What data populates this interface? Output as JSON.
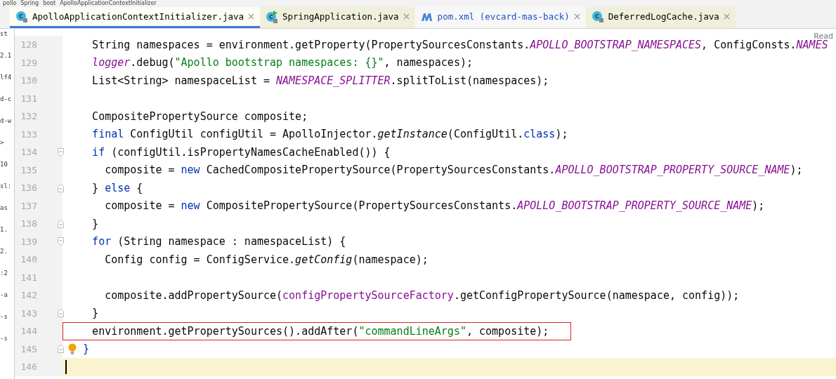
{
  "breadcrumb": [
    "pollo",
    "Spring",
    "boot",
    "ApolloApplicationContextInitializer"
  ],
  "tabs": [
    {
      "label": "ApolloApplicationContextInitializer.java",
      "kind": "class",
      "selected": true,
      "tinted": false,
      "modified": false
    },
    {
      "label": "SpringApplication.java",
      "kind": "runnable",
      "selected": false,
      "tinted": true,
      "modified": false
    },
    {
      "label": "pom.xml (evcard-mas-back)",
      "kind": "maven",
      "selected": false,
      "tinted": false,
      "modified": true
    },
    {
      "label": "DeferredLogCache.java",
      "kind": "class",
      "selected": false,
      "tinted": true,
      "modified": false
    }
  ],
  "project_panel_fragments": [
    "st",
    "2.1",
    "lf4",
    "d-c",
    "d-w",
    ">",
    "10",
    "sl:",
    "as",
    "1.",
    "2.",
    ":2",
    "-a",
    "-s",
    "-s"
  ],
  "reader_mode_label": "Read",
  "lines": [
    {
      "number": "128",
      "fold_start": false,
      "fold_end": false,
      "highlighted": false,
      "current": false,
      "segments": [
        {
          "kind": "plain",
          "text": "    String namespaces = environment.getProperty(PropertySourcesConstants."
        },
        {
          "kind": "constant",
          "text": "APOLLO_BOOTSTRAP_NAMESPACES"
        },
        {
          "kind": "plain",
          "text": ", ConfigConsts."
        },
        {
          "kind": "constant",
          "text": "NAMES"
        }
      ]
    },
    {
      "number": "129",
      "fold_start": false,
      "fold_end": false,
      "highlighted": false,
      "current": false,
      "segments": [
        {
          "kind": "static_field",
          "text": "    logger"
        },
        {
          "kind": "plain",
          "text": ".debug("
        },
        {
          "kind": "string",
          "text": "\"Apollo bootstrap namespaces: {}\""
        },
        {
          "kind": "plain",
          "text": ", namespaces);"
        }
      ]
    },
    {
      "number": "130",
      "fold_start": false,
      "fold_end": false,
      "highlighted": false,
      "current": false,
      "segments": [
        {
          "kind": "plain",
          "text": "    List<String> namespaceList = "
        },
        {
          "kind": "constant",
          "text": "NAMESPACE_SPLITTER"
        },
        {
          "kind": "plain",
          "text": ".splitToList(namespaces);"
        }
      ]
    },
    {
      "number": "131",
      "fold_start": false,
      "fold_end": false,
      "highlighted": false,
      "current": false
    },
    {
      "number": "132",
      "fold_start": false,
      "fold_end": false,
      "highlighted": false,
      "current": false,
      "segments": [
        {
          "kind": "plain",
          "text": "    CompositePropertySource composite;"
        }
      ]
    },
    {
      "number": "133",
      "fold_start": false,
      "fold_end": false,
      "highlighted": false,
      "current": false,
      "segments": [
        {
          "kind": "keyword",
          "text": "    final"
        },
        {
          "kind": "plain",
          "text": " ConfigUtil configUtil = ApolloInjector."
        },
        {
          "kind": "static_call",
          "text": "getInstance"
        },
        {
          "kind": "plain",
          "text": "(ConfigUtil."
        },
        {
          "kind": "keyword",
          "text": "class"
        },
        {
          "kind": "plain",
          "text": ");"
        }
      ]
    },
    {
      "number": "134",
      "fold_start": true,
      "fold_end": false,
      "highlighted": false,
      "current": false,
      "segments": [
        {
          "kind": "keyword",
          "text": "    if"
        },
        {
          "kind": "plain",
          "text": " (configUtil.isPropertyNamesCacheEnabled()) {"
        }
      ]
    },
    {
      "number": "135",
      "fold_start": false,
      "fold_end": false,
      "highlighted": false,
      "current": false,
      "segments": [
        {
          "kind": "plain",
          "text": "      composite = "
        },
        {
          "kind": "keyword",
          "text": "new"
        },
        {
          "kind": "plain",
          "text": " CachedCompositePropertySource(PropertySourcesConstants."
        },
        {
          "kind": "constant",
          "text": "APOLLO_BOOTSTRAP_PROPERTY_SOURCE_NAME"
        },
        {
          "kind": "plain",
          "text": ");"
        }
      ]
    },
    {
      "number": "136",
      "fold_start": false,
      "fold_end": true,
      "highlighted": false,
      "current": false,
      "segments": [
        {
          "kind": "plain",
          "text": "    } "
        },
        {
          "kind": "keyword",
          "text": "else"
        },
        {
          "kind": "plain",
          "text": " {"
        }
      ]
    },
    {
      "number": "137",
      "fold_start": false,
      "fold_end": false,
      "highlighted": false,
      "current": false,
      "segments": [
        {
          "kind": "plain",
          "text": "      composite = "
        },
        {
          "kind": "keyword",
          "text": "new"
        },
        {
          "kind": "plain",
          "text": " CompositePropertySource(PropertySourcesConstants."
        },
        {
          "kind": "constant",
          "text": "APOLLO_BOOTSTRAP_PROPERTY_SOURCE_NAME"
        },
        {
          "kind": "plain",
          "text": ");"
        }
      ]
    },
    {
      "number": "138",
      "fold_start": false,
      "fold_end": true,
      "highlighted": false,
      "current": false,
      "segments": [
        {
          "kind": "plain",
          "text": "    }"
        }
      ]
    },
    {
      "number": "139",
      "fold_start": true,
      "fold_end": false,
      "highlighted": false,
      "current": false,
      "segments": [
        {
          "kind": "keyword",
          "text": "    for"
        },
        {
          "kind": "plain",
          "text": " (String namespace : namespaceList) {"
        }
      ]
    },
    {
      "number": "140",
      "fold_start": false,
      "fold_end": false,
      "highlighted": false,
      "current": false,
      "segments": [
        {
          "kind": "plain",
          "text": "      Config config = ConfigService."
        },
        {
          "kind": "static_call",
          "text": "getConfig"
        },
        {
          "kind": "plain",
          "text": "(namespace);"
        }
      ]
    },
    {
      "number": "141",
      "fold_start": false,
      "fold_end": false,
      "highlighted": false,
      "current": false
    },
    {
      "number": "142",
      "fold_start": false,
      "fold_end": false,
      "highlighted": false,
      "current": false,
      "segments": [
        {
          "kind": "plain",
          "text": "      composite.addPropertySource("
        },
        {
          "kind": "field",
          "text": "configPropertySourceFactory"
        },
        {
          "kind": "plain",
          "text": ".getConfigPropertySource(namespace, config));"
        }
      ]
    },
    {
      "number": "143",
      "fold_start": false,
      "fold_end": true,
      "highlighted": false,
      "current": false,
      "segments": [
        {
          "kind": "plain",
          "text": "    }"
        }
      ]
    },
    {
      "number": "144",
      "fold_start": false,
      "fold_end": false,
      "highlighted": true,
      "current": false,
      "segments": [
        {
          "kind": "plain",
          "text": "    environment.getPropertySources().addAfter("
        },
        {
          "kind": "string",
          "text": "\"commandLineArgs\""
        },
        {
          "kind": "plain",
          "text": ", composite);"
        }
      ]
    },
    {
      "number": "145",
      "fold_start": false,
      "fold_end": true,
      "highlighted": false,
      "current": false,
      "bulb": true,
      "segments": [
        {
          "kind": "brace",
          "text": " }"
        }
      ]
    },
    {
      "number": "146",
      "fold_start": false,
      "fold_end": false,
      "highlighted": false,
      "current": true
    }
  ]
}
